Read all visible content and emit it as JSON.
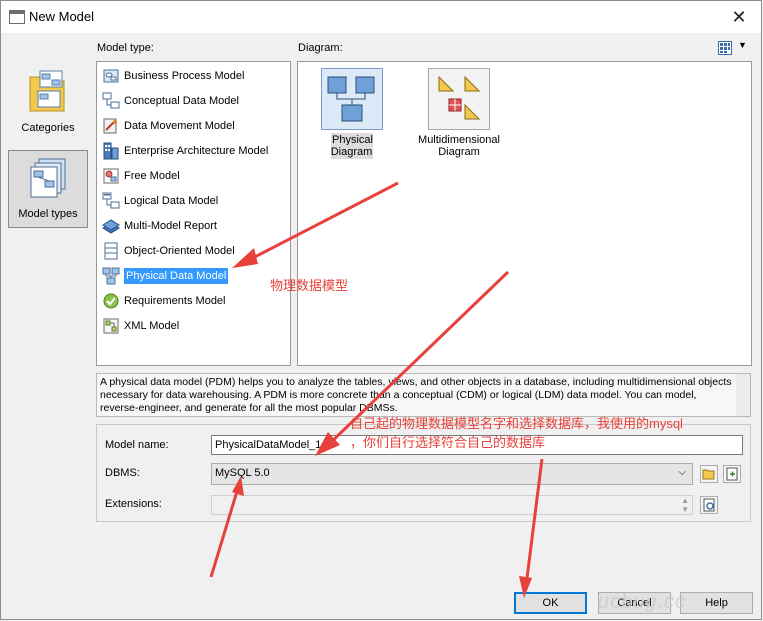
{
  "window": {
    "title": "New Model"
  },
  "categories": [
    {
      "label": "Categories",
      "selected": false
    },
    {
      "label": "Model types",
      "selected": true
    }
  ],
  "model_type_label": "Model type:",
  "diagram_label": "Diagram:",
  "model_types": [
    {
      "label": "Business Process Model",
      "icon": "business-process-icon",
      "selected": false
    },
    {
      "label": "Conceptual Data Model",
      "icon": "conceptual-data-icon",
      "selected": false
    },
    {
      "label": "Data Movement Model",
      "icon": "data-movement-icon",
      "selected": false
    },
    {
      "label": "Enterprise Architecture Model",
      "icon": "enterprise-architecture-icon",
      "selected": false
    },
    {
      "label": "Free Model",
      "icon": "free-model-icon",
      "selected": false
    },
    {
      "label": "Logical Data Model",
      "icon": "logical-data-icon",
      "selected": false
    },
    {
      "label": "Multi-Model Report",
      "icon": "multi-model-report-icon",
      "selected": false
    },
    {
      "label": "Object-Oriented Model",
      "icon": "object-oriented-icon",
      "selected": false
    },
    {
      "label": "Physical Data Model",
      "icon": "physical-data-icon",
      "selected": true
    },
    {
      "label": "Requirements Model",
      "icon": "requirements-icon",
      "selected": false
    },
    {
      "label": "XML Model",
      "icon": "xml-model-icon",
      "selected": false
    }
  ],
  "diagrams": [
    {
      "label": "Physical Diagram",
      "icon": "physical-diagram-icon",
      "selected": true
    },
    {
      "label": "Multidimensional Diagram",
      "icon": "multidimensional-diagram-icon",
      "selected": false
    }
  ],
  "description": "A physical data model (PDM) helps you to analyze the tables, views, and other objects in a database, including multidimensional objects necessary for data warehousing. A PDM is more concrete than a conceptual (CDM) or logical (LDM) data model. You can model, reverse-engineer, and generate for all the most popular DBMSs.",
  "form": {
    "model_name_label": "Model name:",
    "model_name_value": "PhysicalDataModel_1",
    "dbms_label": "DBMS:",
    "dbms_value": "MySQL 5.0",
    "extensions_label": "Extensions:",
    "extensions_value": ""
  },
  "buttons": {
    "ok": "OK",
    "cancel": "Cancel",
    "help": "Help"
  },
  "annotations": {
    "pdm_note": "物理数据模型",
    "name_note_line1": "自己起的物理数据模型名字和选择数据库，我使用的mysql",
    "name_note_line2": "，你们自行选择符合自己的数据库"
  },
  "watermark": "ucbug.cc",
  "colors": {
    "selection": "#3399ff",
    "annotation": "#e8403a",
    "default_button_border": "#0078d7"
  }
}
